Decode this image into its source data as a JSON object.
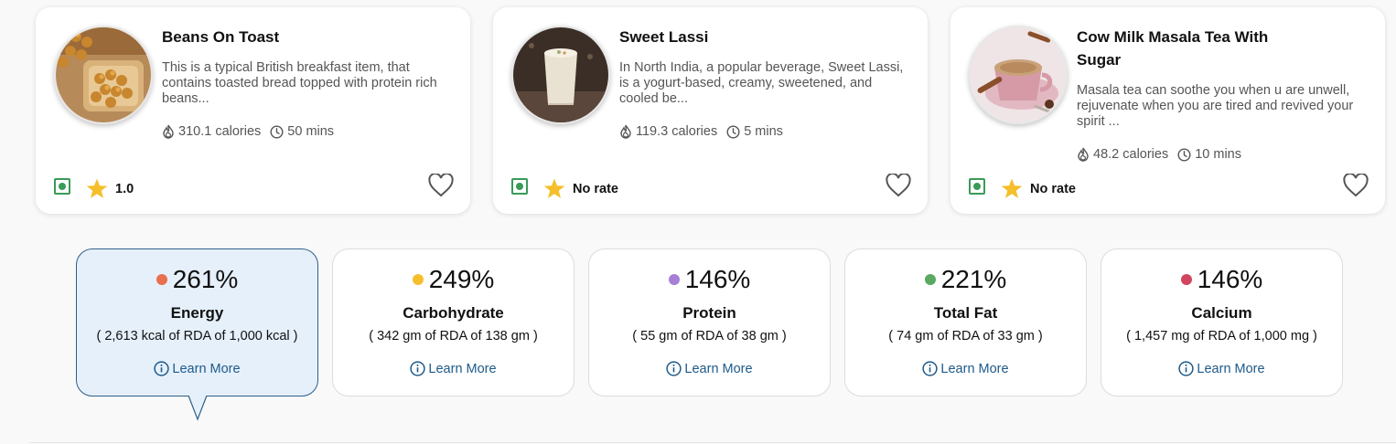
{
  "recipes": [
    {
      "title": "Beans On Toast",
      "description": "This is a typical British breakfast item, that contains toasted bread topped with protein rich beans...",
      "calories": "310.1 calories",
      "time": "50 mins",
      "rating": "1.0",
      "image_icon": "beans-on-toast-photo"
    },
    {
      "title": "Sweet Lassi",
      "description": "In North India, a popular beverage, Sweet Lassi, is a yogurt-based, creamy, sweetened, and cooled be...",
      "calories": "119.3 calories",
      "time": "5 mins",
      "rating": "No rate",
      "image_icon": "sweet-lassi-photo"
    },
    {
      "title": "Cow Milk Masala Tea With Sugar",
      "description": "Masala tea can soothe you when u are unwell, rejuvenate when you are tired and revived your spirit ...",
      "calories": "48.2 calories",
      "time": "10 mins",
      "rating": "No rate",
      "image_icon": "masala-tea-photo"
    }
  ],
  "nutrients": [
    {
      "percent": "261%",
      "name": "Energy",
      "detail": "( 2,613 kcal of RDA of 1,000 kcal )",
      "color": "#e8704e",
      "active": true
    },
    {
      "percent": "249%",
      "name": "Carbohydrate",
      "detail": "( 342 gm of RDA of 138 gm )",
      "color": "#f4bf2a",
      "active": false
    },
    {
      "percent": "146%",
      "name": "Protein",
      "detail": "( 55 gm of RDA of 38 gm )",
      "color": "#a77fd6",
      "active": false
    },
    {
      "percent": "221%",
      "name": "Total Fat",
      "detail": "( 74 gm of RDA of 33 gm )",
      "color": "#5aa960",
      "active": false
    },
    {
      "percent": "146%",
      "name": "Calcium",
      "detail": "( 1,457 mg of RDA of 1,000 mg )",
      "color": "#d1455e",
      "active": false
    }
  ],
  "learn_more_label": "Learn More",
  "icons": {
    "calories": "flame-icon",
    "time": "clock-icon",
    "veg": "veg-indicator-icon",
    "rating": "star-icon",
    "favorite": "heart-icon",
    "info": "info-icon"
  },
  "colors": {
    "star": "#f4bf2a",
    "veg": "#3a9a58",
    "link": "#1d5a8a",
    "active_card_bg": "#e6f0fa",
    "active_card_border": "#2e5f8a"
  }
}
